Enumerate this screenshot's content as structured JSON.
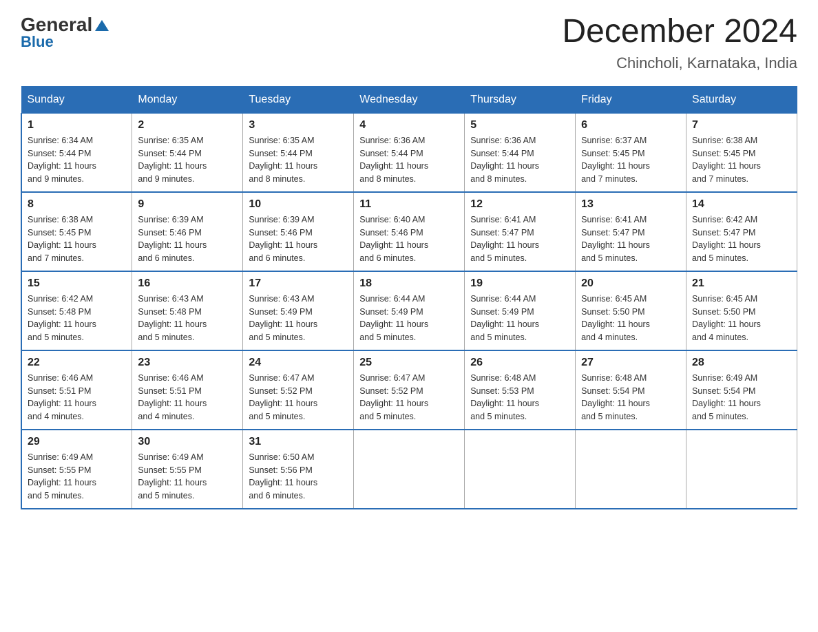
{
  "logo": {
    "general": "General",
    "triangle": "",
    "blue": "Blue"
  },
  "header": {
    "title": "December 2024",
    "subtitle": "Chincholi, Karnataka, India"
  },
  "columns": [
    "Sunday",
    "Monday",
    "Tuesday",
    "Wednesday",
    "Thursday",
    "Friday",
    "Saturday"
  ],
  "weeks": [
    [
      {
        "day": "1",
        "sunrise": "6:34 AM",
        "sunset": "5:44 PM",
        "daylight": "11 hours and 9 minutes."
      },
      {
        "day": "2",
        "sunrise": "6:35 AM",
        "sunset": "5:44 PM",
        "daylight": "11 hours and 9 minutes."
      },
      {
        "day": "3",
        "sunrise": "6:35 AM",
        "sunset": "5:44 PM",
        "daylight": "11 hours and 8 minutes."
      },
      {
        "day": "4",
        "sunrise": "6:36 AM",
        "sunset": "5:44 PM",
        "daylight": "11 hours and 8 minutes."
      },
      {
        "day": "5",
        "sunrise": "6:36 AM",
        "sunset": "5:44 PM",
        "daylight": "11 hours and 8 minutes."
      },
      {
        "day": "6",
        "sunrise": "6:37 AM",
        "sunset": "5:45 PM",
        "daylight": "11 hours and 7 minutes."
      },
      {
        "day": "7",
        "sunrise": "6:38 AM",
        "sunset": "5:45 PM",
        "daylight": "11 hours and 7 minutes."
      }
    ],
    [
      {
        "day": "8",
        "sunrise": "6:38 AM",
        "sunset": "5:45 PM",
        "daylight": "11 hours and 7 minutes."
      },
      {
        "day": "9",
        "sunrise": "6:39 AM",
        "sunset": "5:46 PM",
        "daylight": "11 hours and 6 minutes."
      },
      {
        "day": "10",
        "sunrise": "6:39 AM",
        "sunset": "5:46 PM",
        "daylight": "11 hours and 6 minutes."
      },
      {
        "day": "11",
        "sunrise": "6:40 AM",
        "sunset": "5:46 PM",
        "daylight": "11 hours and 6 minutes."
      },
      {
        "day": "12",
        "sunrise": "6:41 AM",
        "sunset": "5:47 PM",
        "daylight": "11 hours and 5 minutes."
      },
      {
        "day": "13",
        "sunrise": "6:41 AM",
        "sunset": "5:47 PM",
        "daylight": "11 hours and 5 minutes."
      },
      {
        "day": "14",
        "sunrise": "6:42 AM",
        "sunset": "5:47 PM",
        "daylight": "11 hours and 5 minutes."
      }
    ],
    [
      {
        "day": "15",
        "sunrise": "6:42 AM",
        "sunset": "5:48 PM",
        "daylight": "11 hours and 5 minutes."
      },
      {
        "day": "16",
        "sunrise": "6:43 AM",
        "sunset": "5:48 PM",
        "daylight": "11 hours and 5 minutes."
      },
      {
        "day": "17",
        "sunrise": "6:43 AM",
        "sunset": "5:49 PM",
        "daylight": "11 hours and 5 minutes."
      },
      {
        "day": "18",
        "sunrise": "6:44 AM",
        "sunset": "5:49 PM",
        "daylight": "11 hours and 5 minutes."
      },
      {
        "day": "19",
        "sunrise": "6:44 AM",
        "sunset": "5:49 PM",
        "daylight": "11 hours and 5 minutes."
      },
      {
        "day": "20",
        "sunrise": "6:45 AM",
        "sunset": "5:50 PM",
        "daylight": "11 hours and 4 minutes."
      },
      {
        "day": "21",
        "sunrise": "6:45 AM",
        "sunset": "5:50 PM",
        "daylight": "11 hours and 4 minutes."
      }
    ],
    [
      {
        "day": "22",
        "sunrise": "6:46 AM",
        "sunset": "5:51 PM",
        "daylight": "11 hours and 4 minutes."
      },
      {
        "day": "23",
        "sunrise": "6:46 AM",
        "sunset": "5:51 PM",
        "daylight": "11 hours and 4 minutes."
      },
      {
        "day": "24",
        "sunrise": "6:47 AM",
        "sunset": "5:52 PM",
        "daylight": "11 hours and 5 minutes."
      },
      {
        "day": "25",
        "sunrise": "6:47 AM",
        "sunset": "5:52 PM",
        "daylight": "11 hours and 5 minutes."
      },
      {
        "day": "26",
        "sunrise": "6:48 AM",
        "sunset": "5:53 PM",
        "daylight": "11 hours and 5 minutes."
      },
      {
        "day": "27",
        "sunrise": "6:48 AM",
        "sunset": "5:54 PM",
        "daylight": "11 hours and 5 minutes."
      },
      {
        "day": "28",
        "sunrise": "6:49 AM",
        "sunset": "5:54 PM",
        "daylight": "11 hours and 5 minutes."
      }
    ],
    [
      {
        "day": "29",
        "sunrise": "6:49 AM",
        "sunset": "5:55 PM",
        "daylight": "11 hours and 5 minutes."
      },
      {
        "day": "30",
        "sunrise": "6:49 AM",
        "sunset": "5:55 PM",
        "daylight": "11 hours and 5 minutes."
      },
      {
        "day": "31",
        "sunrise": "6:50 AM",
        "sunset": "5:56 PM",
        "daylight": "11 hours and 6 minutes."
      },
      null,
      null,
      null,
      null
    ]
  ],
  "labels": {
    "sunrise": "Sunrise:",
    "sunset": "Sunset:",
    "daylight": "Daylight:"
  }
}
